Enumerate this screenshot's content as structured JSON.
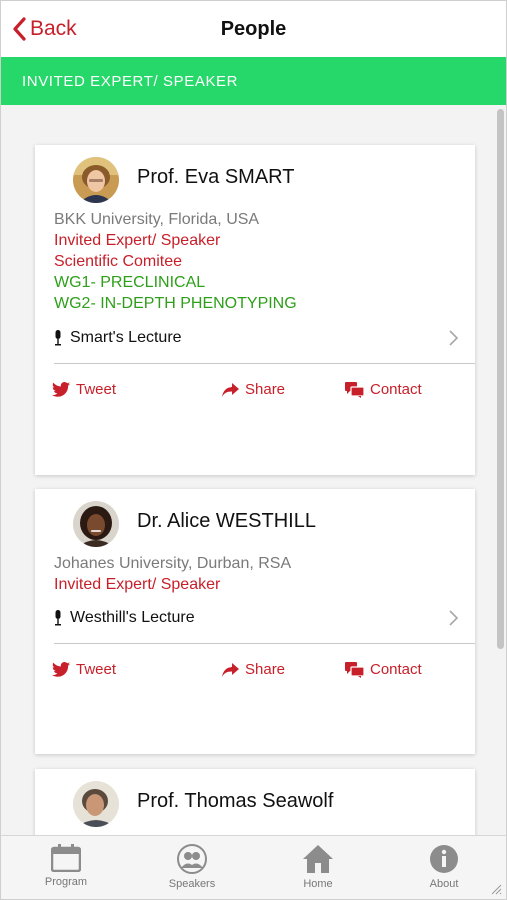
{
  "header": {
    "back_label": "Back",
    "title": "People"
  },
  "section": {
    "title": "INVITED EXPERT/ SPEAKER"
  },
  "people": [
    {
      "name": "Prof. Eva SMART",
      "affiliation": "BKK University, Florida, USA",
      "roles": [
        "Invited Expert/ Speaker",
        "Scientific Comitee"
      ],
      "groups": [
        "WG1- PRECLINICAL",
        "WG2- IN-DEPTH PHENOTYPING"
      ],
      "lecture": "Smart's Lecture"
    },
    {
      "name": "Dr. Alice WESTHILL",
      "affiliation": "Johanes University, Durban, RSA",
      "roles": [
        "Invited Expert/ Speaker"
      ],
      "groups": [],
      "lecture": "Westhill's Lecture"
    },
    {
      "name": "Prof. Thomas Seawolf"
    }
  ],
  "actions": {
    "tweet": "Tweet",
    "share": "Share",
    "contact": "Contact"
  },
  "tabs": [
    {
      "label": "Program",
      "icon": "calendar-icon"
    },
    {
      "label": "Speakers",
      "icon": "people-icon"
    },
    {
      "label": "Home",
      "icon": "home-icon"
    },
    {
      "label": "About",
      "icon": "info-icon"
    }
  ],
  "colors": {
    "accent_red": "#c8202a",
    "section_green": "#26d86a",
    "group_green": "#2e9f1a"
  }
}
